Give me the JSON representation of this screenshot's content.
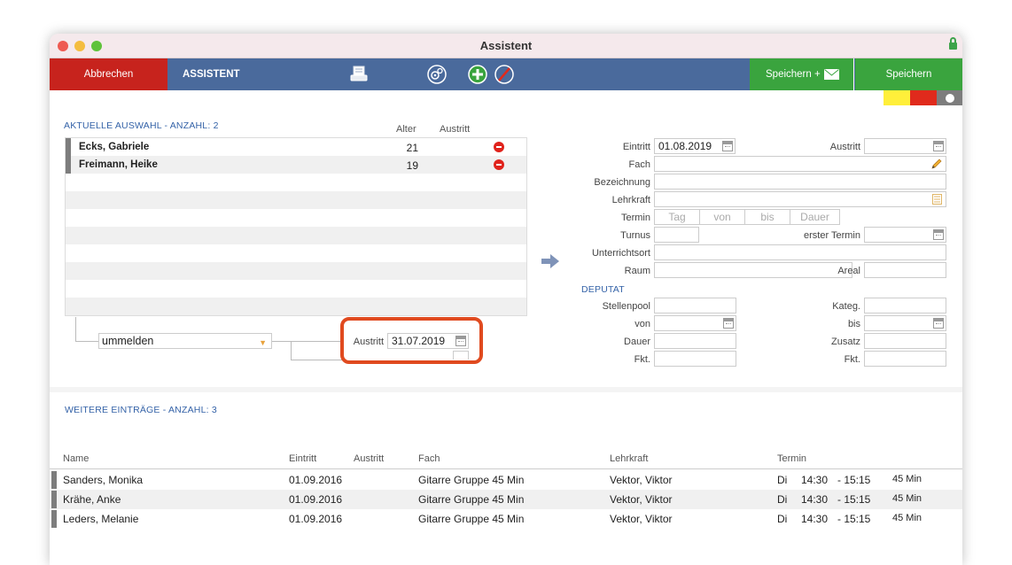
{
  "window": {
    "title": "Assistent"
  },
  "toolbar": {
    "cancel_label": "Abbrechen",
    "section_label": "ASSISTENT",
    "save_mail_label": "Speichern +",
    "save_label": "Speichern"
  },
  "status_colors": {
    "yellow": "#ffef3a",
    "red": "#e02a1c",
    "toggle": "#7d7d7d"
  },
  "selection": {
    "title": "AKTUELLE AUSWAHL - ANZAHL: 2",
    "col_age": "Alter",
    "col_exit": "Austritt",
    "rows": [
      {
        "name": "Ecks, Gabriele",
        "age": "21"
      },
      {
        "name": "Freimann, Heike",
        "age": "19"
      }
    ]
  },
  "action": {
    "select_value": "ummelden",
    "exit_label": "Austritt",
    "exit_value": "31.07.2019"
  },
  "form": {
    "eintritt_label": "Eintritt",
    "eintritt_value": "01.08.2019",
    "austritt_label": "Austritt",
    "fach_label": "Fach",
    "bezeichnung_label": "Bezeichnung",
    "lehrkraft_label": "Lehrkraft",
    "termin_label": "Termin",
    "termin_day_ph": "Tag",
    "termin_from_ph": "von",
    "termin_to_ph": "bis",
    "termin_duration_ph": "Dauer",
    "turnus_label": "Turnus",
    "erster_termin_label": "erster Termin",
    "unterrichtsort_label": "Unterrichtsort",
    "raum_label": "Raum",
    "areal_label": "Areal",
    "deputat_title": "DEPUTAT",
    "stellenpool_label": "Stellenpool",
    "kateg_label": "Kateg.",
    "von_label": "von",
    "bis_label": "bis",
    "dauer_label": "Dauer",
    "zusatz_label": "Zusatz",
    "fkt_label": "Fkt.",
    "fkt2_label": "Fkt."
  },
  "entries": {
    "title": "WEITERE EINTRÄGE - ANZAHL: 3",
    "headers": {
      "name": "Name",
      "eintritt": "Eintritt",
      "austritt": "Austritt",
      "fach": "Fach",
      "lehrkraft": "Lehrkraft",
      "termin": "Termin"
    },
    "rows": [
      {
        "name": "Sanders, Monika",
        "eintritt": "01.09.2016",
        "fach": "Gitarre Gruppe 45 Min",
        "lehrkraft": "Vektor, Viktor",
        "day": "Di",
        "from": "14:30",
        "to": "- 15:15",
        "dur": "45 Min"
      },
      {
        "name": "Krähe, Anke",
        "eintritt": "01.09.2016",
        "fach": "Gitarre Gruppe 45 Min",
        "lehrkraft": "Vektor, Viktor",
        "day": "Di",
        "from": "14:30",
        "to": "- 15:15",
        "dur": "45 Min"
      },
      {
        "name": "Leders, Melanie",
        "eintritt": "01.09.2016",
        "fach": "Gitarre Gruppe 45 Min",
        "lehrkraft": "Vektor, Viktor",
        "day": "Di",
        "from": "14:30",
        "to": "- 15:15",
        "dur": "45 Min"
      }
    ]
  },
  "icons": [
    "lock-icon",
    "printer-icon",
    "settings-icon",
    "add-icon",
    "delete-icon",
    "envelope-icon",
    "calendar-icon",
    "pencil-icon",
    "list-icon",
    "arrow-right-icon",
    "remove-icon"
  ]
}
